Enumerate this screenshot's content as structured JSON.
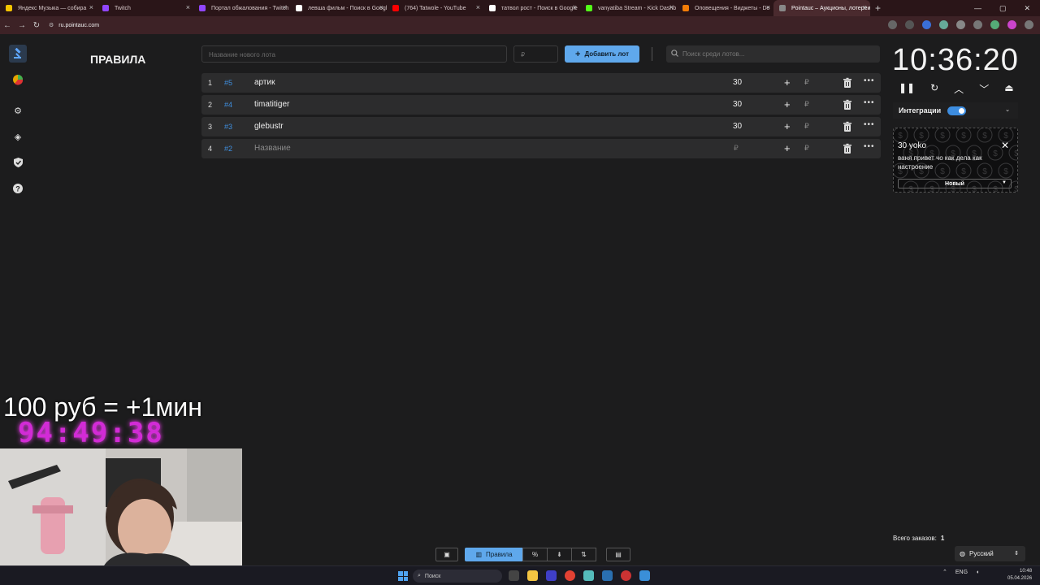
{
  "browser": {
    "tabs": [
      {
        "label": "Яндекс Музыка — собира",
        "color": "#f5c400",
        "active": false
      },
      {
        "label": "Twitch",
        "color": "#9146ff",
        "active": false
      },
      {
        "label": "Портал обжалования - Twitch",
        "color": "#9146ff",
        "active": false
      },
      {
        "label": "левша фильм - Поиск в Googl",
        "color": "#ffffff",
        "active": false
      },
      {
        "label": "(764) Tatwole - YouTube",
        "color": "#ff0000",
        "active": false
      },
      {
        "label": "татвол рост - Поиск в Google",
        "color": "#ffffff",
        "active": false
      },
      {
        "label": "vanyatiba Stream - Kick Dashb",
        "color": "#53fc18",
        "active": false
      },
      {
        "label": "Оповещения - Виджеты - Do",
        "color": "#f57d07",
        "active": false
      },
      {
        "label": "Pointauc – Аукционы, лотереи",
        "color": "#888888",
        "active": true
      }
    ],
    "new_tab": "+",
    "url": "ru.pointauc.com"
  },
  "page": {
    "title": "ПРАВИЛА",
    "lot_name_placeholder": "Название нового лота",
    "amount_placeholder": "₽",
    "add_button": "Добавить лот",
    "search_placeholder": "Поиск среди лотов...",
    "lots": [
      {
        "index": "1",
        "id": "#5",
        "name": "артик",
        "amount": "30",
        "placeholder": false
      },
      {
        "index": "2",
        "id": "#4",
        "name": "timatitiger",
        "amount": "30",
        "placeholder": false
      },
      {
        "index": "3",
        "id": "#3",
        "name": "glebustr",
        "amount": "30",
        "placeholder": false
      },
      {
        "index": "4",
        "id": "#2",
        "name": "Название",
        "amount": "₽",
        "placeholder": true
      }
    ],
    "rub_symbol": "₽"
  },
  "timer": {
    "time": "10:36:20"
  },
  "integrations": {
    "label": "Интеграции",
    "enabled": true
  },
  "donation": {
    "title": "30 yoko",
    "message": "ваня привет чо как дела как настроение",
    "status": "Новый"
  },
  "orders": {
    "label": "Всего заказов:",
    "count": "1"
  },
  "language": "Русский",
  "toolbar": {
    "rules_label": "Правила"
  },
  "overlay": {
    "price_text": "100 руб = +1мин",
    "stream_timer": "94:49:38"
  },
  "taskbar": {
    "search": "Поиск",
    "lang": "ENG",
    "time": "10:48",
    "date": "05.04.2026"
  }
}
